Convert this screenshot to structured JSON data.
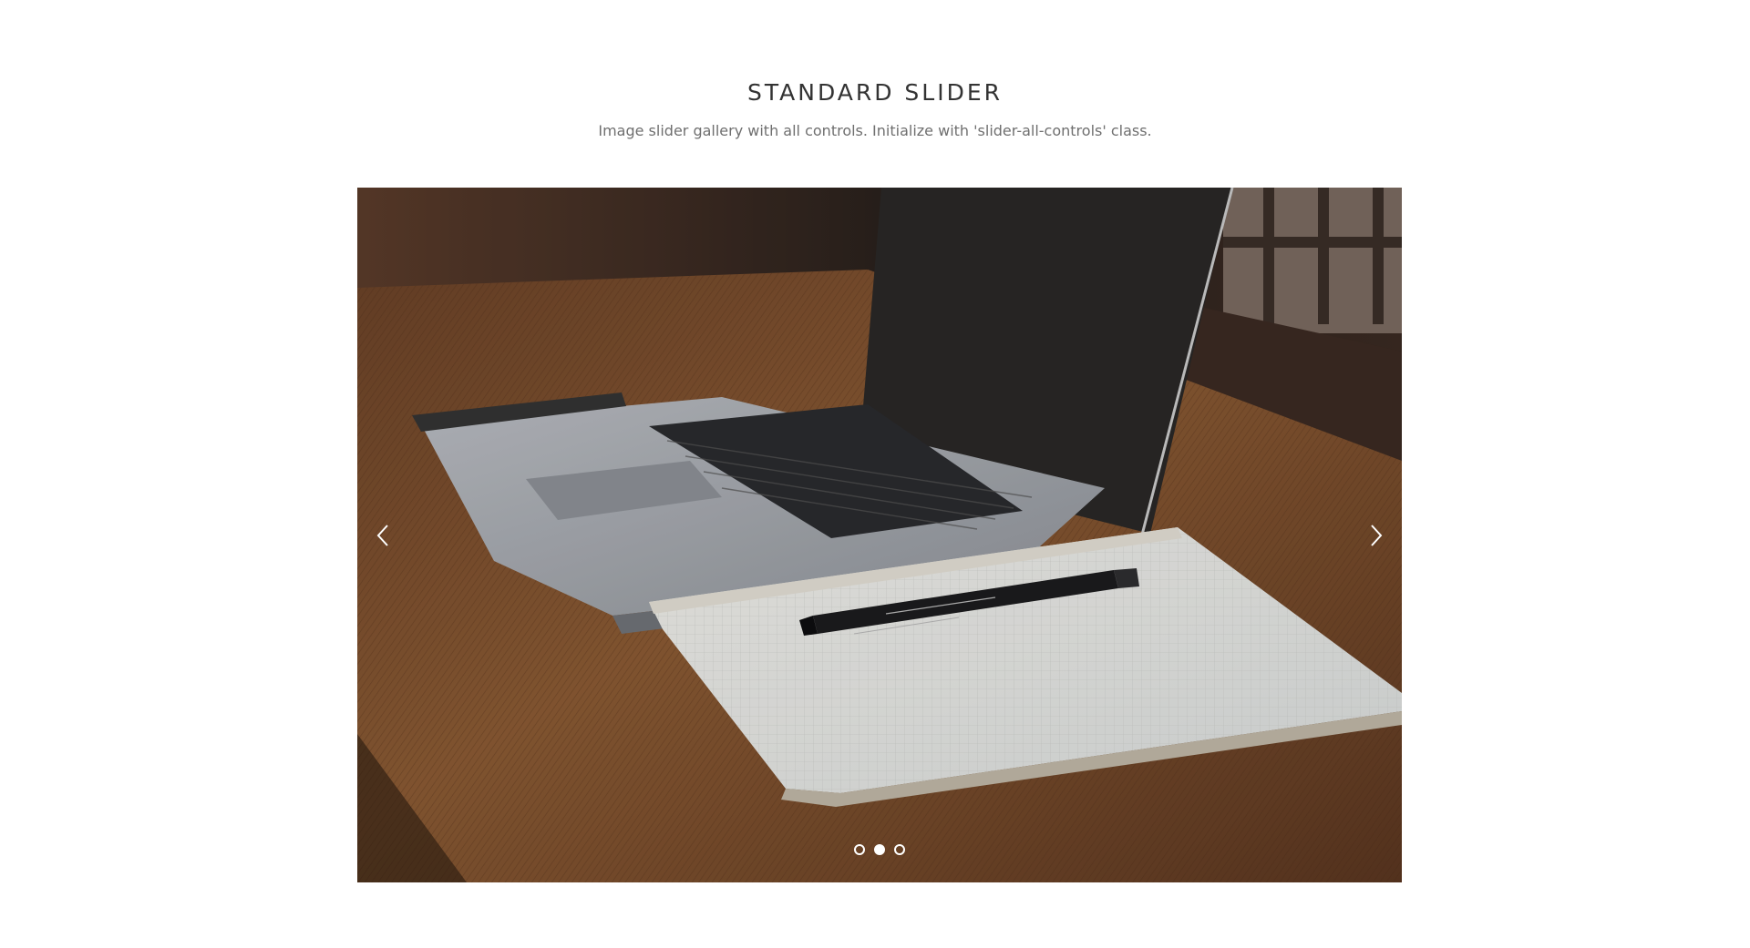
{
  "header": {
    "title": "STANDARD SLIDER",
    "subtitle": "Image slider gallery with all controls. Initialize with 'slider-all-controls' class."
  },
  "slider": {
    "image_subject": "laptop-notebook-pen-on-wooden-desk",
    "prev_icon": "chevron-left-icon",
    "next_icon": "chevron-right-icon",
    "dots": [
      {
        "active": false
      },
      {
        "active": true
      },
      {
        "active": false
      }
    ]
  },
  "colors": {
    "title": "#333333",
    "subtitle": "#6f6f6f",
    "control": "#ffffff"
  }
}
